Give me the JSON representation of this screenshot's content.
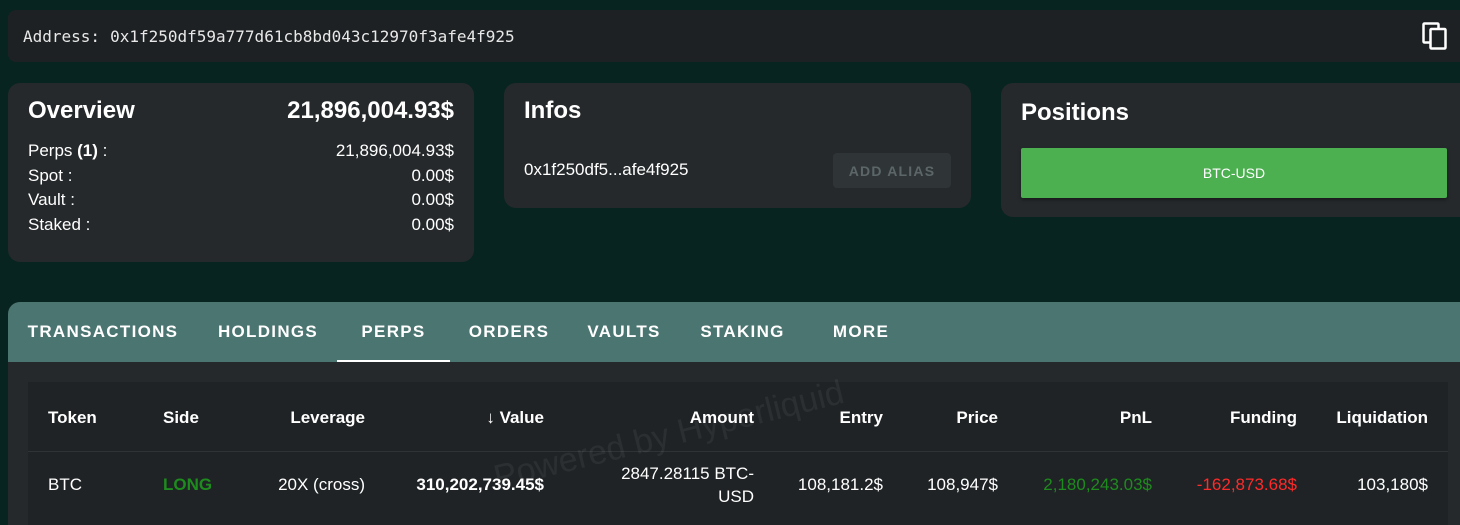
{
  "address_bar": {
    "label": "Address:",
    "value": "0x1f250df59a777d61cb8bd043c12970f3afe4f925"
  },
  "overview": {
    "title": "Overview",
    "total": "21,896,004.93$",
    "rows": [
      {
        "label": "Perps ",
        "count": "(1)",
        "suffix": " :",
        "value": "21,896,004.93$"
      },
      {
        "label": "Spot :",
        "value": "0.00$"
      },
      {
        "label": "Vault :",
        "value": "0.00$"
      },
      {
        "label": "Staked :",
        "value": "0.00$"
      }
    ]
  },
  "infos": {
    "title": "Infos",
    "short_address": "0x1f250df5...afe4f925",
    "add_alias_label": "ADD ALIAS"
  },
  "positions": {
    "title": "Positions",
    "button_label": "BTC-USD"
  },
  "tabs": [
    {
      "label": "TRANSACTIONS"
    },
    {
      "label": "HOLDINGS"
    },
    {
      "label": "PERPS",
      "active": true
    },
    {
      "label": "ORDERS"
    },
    {
      "label": "VAULTS"
    },
    {
      "label": "STAKING"
    },
    {
      "label": "MORE"
    }
  ],
  "table": {
    "headers": [
      "Token",
      "Side",
      "Leverage",
      "Value",
      "Amount",
      "Entry",
      "Price",
      "PnL",
      "Funding",
      "Liquidation"
    ],
    "sort_indicator": "↓",
    "rows": [
      {
        "token": "BTC",
        "side": "LONG",
        "leverage": "20X (cross)",
        "value": "310,202,739.45$",
        "amount_line1": "2847.28115 BTC-",
        "amount_line2": "USD",
        "entry": "108,181.2$",
        "price": "108,947$",
        "pnl": "2,180,243.03$",
        "funding": "-162,873.68$",
        "liquidation": "103,180$"
      }
    ]
  },
  "watermark": "Powered by Hyperliquid",
  "colors": {
    "background": "#072420",
    "card": "#25292b",
    "tabbar": "#4b7571",
    "long": "#1e8b1e",
    "pnl_positive": "#1e8b1e",
    "funding_negative": "#ff2a2a",
    "positions_button": "#4caf50"
  }
}
